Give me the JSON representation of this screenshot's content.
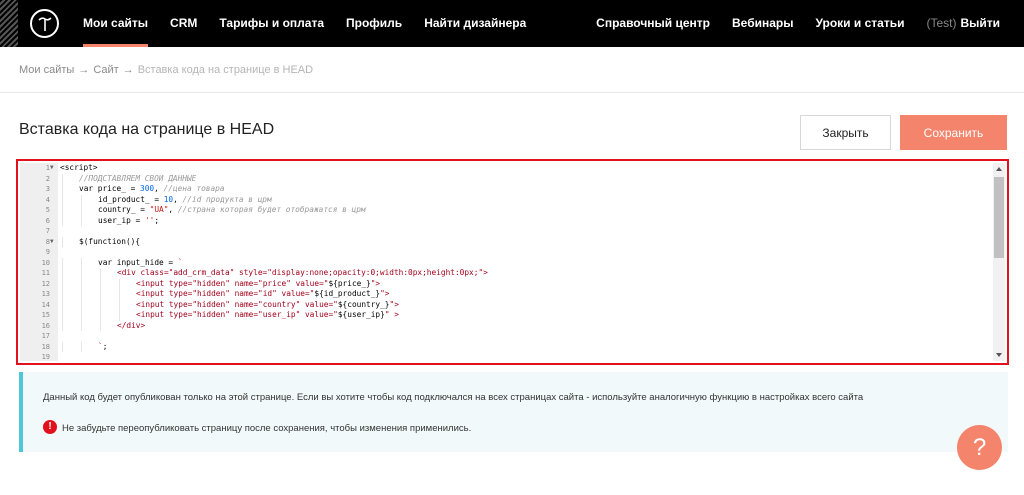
{
  "nav": {
    "left_items": [
      "Мои сайты",
      "CRM",
      "Тарифы и оплата",
      "Профиль",
      "Найти дизайнера"
    ],
    "active_index": 0,
    "right_items": [
      "Справочный центр",
      "Вебинары",
      "Уроки и статьи"
    ],
    "user_tag": "(Test)",
    "logout": "Выйти",
    "accent": "#f4846b"
  },
  "breadcrumb": {
    "sites": "Мои сайты",
    "separator": "→",
    "site": "Сайт",
    "current": "Вставка кода на странице в HEAD"
  },
  "page": {
    "title": "Вставка кода на странице в HEAD",
    "close_label": "Закрыть",
    "save_label": "Сохранить"
  },
  "editor": {
    "lines": [
      {
        "n": "1",
        "fold": true,
        "indent": 0,
        "parts": [
          [
            "tag",
            "<script>"
          ]
        ]
      },
      {
        "n": "2",
        "indent": 1,
        "parts": [
          [
            "cm",
            "//ПОДСТАВЛЯЕМ СВОИ ДАННЫЕ"
          ]
        ]
      },
      {
        "n": "3",
        "indent": 1,
        "parts": [
          [
            "tag",
            "var price_ = "
          ],
          [
            "num",
            "300"
          ],
          [
            "tag",
            ", "
          ],
          [
            "cm",
            "//цена товара"
          ]
        ]
      },
      {
        "n": "4",
        "indent": 2,
        "parts": [
          [
            "tag",
            "id_product_ = "
          ],
          [
            "num",
            "10"
          ],
          [
            "tag",
            ", "
          ],
          [
            "cm",
            "//id продукта в црм"
          ]
        ]
      },
      {
        "n": "5",
        "indent": 2,
        "parts": [
          [
            "tag",
            "country_ = "
          ],
          [
            "str",
            "\"UA\""
          ],
          [
            "tag",
            ", "
          ],
          [
            "cm",
            "//страна которая будет отображатся в црм"
          ]
        ]
      },
      {
        "n": "6",
        "indent": 2,
        "parts": [
          [
            "tag",
            "user_ip = "
          ],
          [
            "str",
            "''"
          ],
          [
            "tag",
            ";"
          ]
        ]
      },
      {
        "n": "7",
        "indent": 0,
        "parts": []
      },
      {
        "n": "8",
        "fold": true,
        "indent": 1,
        "parts": [
          [
            "tag",
            "$(function(){"
          ]
        ]
      },
      {
        "n": "9",
        "indent": 0,
        "parts": []
      },
      {
        "n": "10",
        "indent": 2,
        "parts": [
          [
            "tag",
            "var input_hide = "
          ],
          [
            "str",
            "`"
          ]
        ]
      },
      {
        "n": "11",
        "indent": 3,
        "parts": [
          [
            "html",
            "<div class=\"add_crm_data\" style=\"display:none;opacity:0;width:0px;height:0px;\">"
          ]
        ]
      },
      {
        "n": "12",
        "indent": 4,
        "parts": [
          [
            "html",
            "<input type=\"hidden\" name=\"price\" value=\""
          ],
          [
            "tag",
            "${price_}"
          ],
          [
            "html",
            "\">"
          ]
        ]
      },
      {
        "n": "13",
        "indent": 4,
        "parts": [
          [
            "html",
            "<input type=\"hidden\" name=\"id\" value=\""
          ],
          [
            "tag",
            "${id_product_}"
          ],
          [
            "html",
            "\">"
          ]
        ]
      },
      {
        "n": "14",
        "indent": 4,
        "parts": [
          [
            "html",
            "<input type=\"hidden\" name=\"country\" value=\""
          ],
          [
            "tag",
            "${country_}"
          ],
          [
            "html",
            "\">"
          ]
        ]
      },
      {
        "n": "15",
        "indent": 4,
        "parts": [
          [
            "html",
            "<input type=\"hidden\" name=\"user_ip\" value=\""
          ],
          [
            "tag",
            "${user_ip}"
          ],
          [
            "html",
            "\" >"
          ]
        ]
      },
      {
        "n": "16",
        "indent": 3,
        "parts": [
          [
            "html",
            "</div>"
          ]
        ]
      },
      {
        "n": "17",
        "indent": 0,
        "parts": []
      },
      {
        "n": "18",
        "indent": 2,
        "parts": [
          [
            "str",
            "`"
          ],
          [
            "tag",
            ";"
          ]
        ]
      },
      {
        "n": "19",
        "indent": 0,
        "parts": []
      }
    ]
  },
  "info": {
    "text": "Данный код будет опубликован только на этой странице. Если вы хотите чтобы код подключался на всех страницах сайта - используйте аналогичную функцию в настройках всего сайта",
    "warning_icon": "!",
    "warning": "Не забудьте переопубликовать страницу после сохранения, чтобы изменения применились."
  },
  "help": {
    "label": "?"
  }
}
